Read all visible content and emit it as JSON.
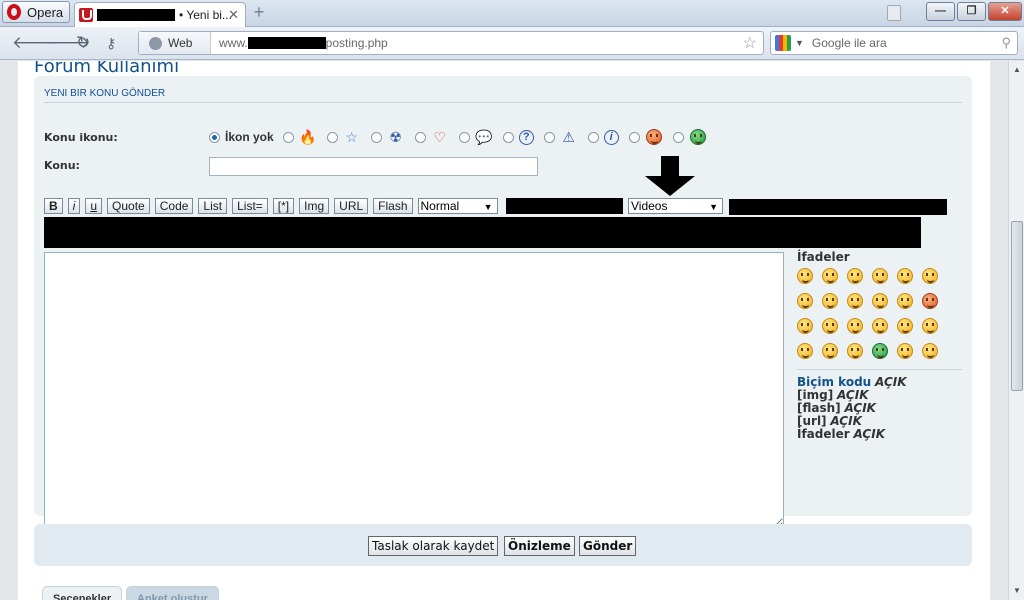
{
  "browser": {
    "menu_label": "Opera",
    "tab_title": "• Yeni bi...",
    "tab_close": "✕",
    "new_tab": "+",
    "address_mode": "Web",
    "address_prefix": "www.",
    "address_suffix": "posting.php",
    "search_placeholder": "Google ile ara",
    "window_controls": {
      "minimize": "—",
      "maximize": "❐",
      "close": "✕"
    }
  },
  "page": {
    "forum_title": "Forum Kullanımı",
    "section_heading": "YENI BIR KONU GÖNDER",
    "topic_icon_label": "Konu ikonu:",
    "no_icon_label": "İkon yok",
    "subject_label": "Konu:",
    "subject_value": "",
    "topic_icons": [
      "flame-icon",
      "star-icon",
      "radiation-icon",
      "heart-icon",
      "speech-bubble-icon",
      "question-icon",
      "warning-icon",
      "info-icon",
      "mad-face-icon",
      "grin-face-icon"
    ],
    "toolbar": {
      "buttons": [
        "B",
        "i",
        "u",
        "Quote",
        "Code",
        "List",
        "List=",
        "[*]",
        "Img",
        "URL",
        "Flash"
      ],
      "font_size_value": "Normal",
      "videos_value": "Videos"
    },
    "message_value": "",
    "smilies": {
      "title": "İfadeler",
      "count": 24
    },
    "format_status": {
      "bbcode_label": "Biçim kodu",
      "bbcode_value": "AÇIK",
      "img_label": "[img]",
      "img_value": "AÇIK",
      "flash_label": "[flash]",
      "flash_value": "AÇIK",
      "url_label": "[url]",
      "url_value": "AÇIK",
      "smilies_label": "İfadeler",
      "smilies_value": "AÇIK"
    },
    "actions": {
      "save_draft": "Taslak olarak kaydet",
      "preview": "Önizleme",
      "submit": "Gönder"
    },
    "lower_tabs": [
      "Seçenekler",
      "Anket oluştur"
    ]
  },
  "colors": {
    "link_blue": "#105289",
    "panel_bg": "#ecf1f3",
    "accent_red": "#cc0f16"
  }
}
